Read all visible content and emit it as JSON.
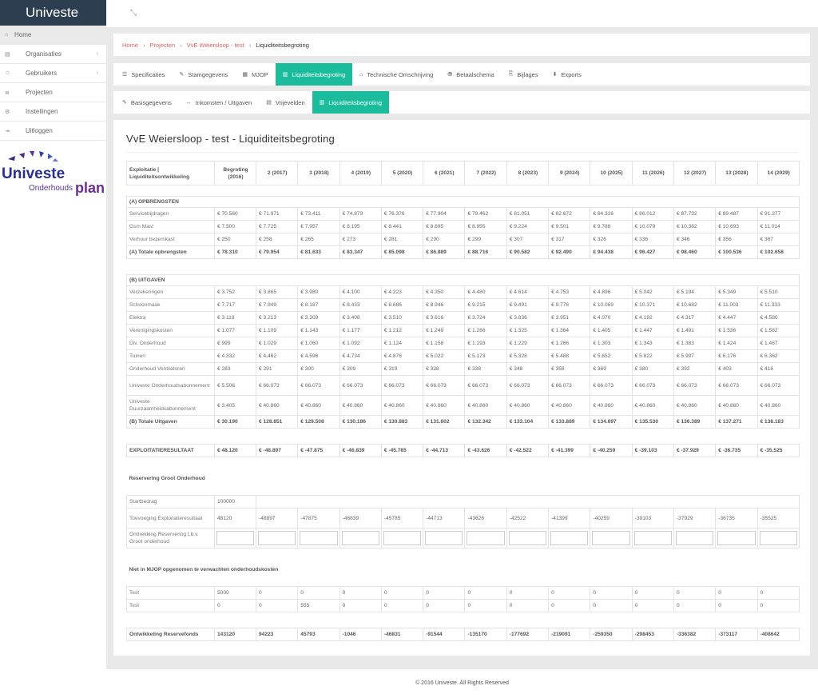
{
  "app_title": "Univeste",
  "sidebar": {
    "items": [
      {
        "icon": "dashboard-icon",
        "glyph": "⌂",
        "label": "Home"
      },
      {
        "icon": "building-icon",
        "glyph": "▤",
        "label": "Organisaties",
        "chevron": "‹"
      },
      {
        "icon": "users-icon",
        "glyph": "☺",
        "label": "Gebruikers",
        "chevron": "‹"
      },
      {
        "icon": "list-icon",
        "glyph": "≣",
        "label": "Projecten"
      },
      {
        "icon": "gear-icon",
        "glyph": "⚙",
        "label": "Instellingen"
      },
      {
        "icon": "logout-icon",
        "glyph": "⇥",
        "label": "Uitloggen"
      }
    ]
  },
  "logo": {
    "word": "Univeste",
    "sub": "Onderhouds",
    "plan": "plan"
  },
  "topbar": {
    "expand_glyph": "⤡"
  },
  "breadcrumb": {
    "home": "Home",
    "projects": "Projecten",
    "project": "VvE Weiersloop - test",
    "current": "Liquiditeitsbegroting"
  },
  "tabs1": [
    {
      "glyph": "☰",
      "label": "Specificaties"
    },
    {
      "glyph": "✎",
      "label": "Stamgegevens"
    },
    {
      "glyph": "▦",
      "label": "MJOP"
    },
    {
      "glyph": "▥",
      "label": "Liquiditeitsbegroting",
      "active": true
    },
    {
      "glyph": "⌂",
      "label": "Technische Omschrijving"
    },
    {
      "glyph": "⛃",
      "label": "Betaalschema"
    },
    {
      "glyph": "⎘",
      "label": "Bijlages"
    },
    {
      "glyph": "⬇",
      "label": "Exports"
    }
  ],
  "tabs2": [
    {
      "glyph": "✎",
      "label": "Basisgegevens"
    },
    {
      "glyph": "↔",
      "label": "Inkomsten / Uitgaven"
    },
    {
      "glyph": "▤",
      "label": "Vrijevelden"
    },
    {
      "glyph": "▥",
      "label": "Liquiditeitsbegroting",
      "active": true
    }
  ],
  "page_title": "VvE Weiersloop - test - Liquiditeitsbegroting",
  "table": {
    "head_label": "Exploitatie | Liquiditeitsontwikkeling",
    "columns": [
      "Begroting (2016)",
      "2 (2017)",
      "3 (2018)",
      "4 (2019)",
      "5 (2020)",
      "6 (2021)",
      "7 (2022)",
      "8 (2023)",
      "9 (2024)",
      "10 (2025)",
      "11 (2026)",
      "12 (2027)",
      "13 (2028)",
      "14 (2029)"
    ],
    "income_title": "(A) OPBRENGSTEN",
    "income_rows": [
      {
        "label": "Servicebijdragen",
        "values": [
          "€ 70.560",
          "€ 71.971",
          "€ 73.411",
          "€ 74.879",
          "€ 76.376",
          "€ 77.904",
          "€ 79.462",
          "€ 81.051",
          "€ 82.672",
          "€ 84.326",
          "€ 86.012",
          "€ 87.732",
          "€ 89.487",
          "€ 91.277"
        ]
      },
      {
        "label": "Gsm Mast",
        "values": [
          "€ 7.500",
          "€ 7.725",
          "€ 7.957",
          "€ 8.195",
          "€ 8.441",
          "€ 8.695",
          "€ 8.955",
          "€ 9.224",
          "€ 9.501",
          "€ 9.786",
          "€ 10.079",
          "€ 10.382",
          "€ 10.693",
          "€ 11.014"
        ]
      },
      {
        "label": "Verhuur bezemkast",
        "values": [
          "€ 250",
          "€ 258",
          "€ 265",
          "€ 273",
          "€ 281",
          "€ 290",
          "€ 299",
          "€ 307",
          "€ 317",
          "€ 326",
          "€ 336",
          "€ 346",
          "€ 356",
          "€ 367"
        ]
      }
    ],
    "income_total": {
      "label": "(A) Totale opbrengsten",
      "values": [
        "€ 78.310",
        "€ 79.954",
        "€ 81.633",
        "€ 83.347",
        "€ 85.098",
        "€ 86.889",
        "€ 88.716",
        "€ 90.582",
        "€ 92.490",
        "€ 94.438",
        "€ 96.427",
        "€ 98.460",
        "€ 100.536",
        "€ 102.658"
      ]
    },
    "expense_title": "(B) UITGAVEN",
    "expense_rows": [
      {
        "label": "Verzekeringen",
        "values": [
          "€ 3.752",
          "€ 3.865",
          "€ 3.980",
          "€ 4.100",
          "€ 4.223",
          "€ 4.350",
          "€ 4.480",
          "€ 4.614",
          "€ 4.753",
          "€ 4.896",
          "€ 5.042",
          "€ 5.194",
          "€ 5.349",
          "€ 5.510"
        ]
      },
      {
        "label": "Schoonmaak",
        "values": [
          "€ 7.717",
          "€ 7.949",
          "€ 8.187",
          "€ 8.433",
          "€ 8.686",
          "€ 8.946",
          "€ 9.215",
          "€ 9.491",
          "€ 9.776",
          "€ 10.069",
          "€ 10.371",
          "€ 10.682",
          "€ 11.003",
          "€ 11.333"
        ]
      },
      {
        "label": "Elektra",
        "values": [
          "€ 3.119",
          "€ 3.213",
          "€ 3.309",
          "€ 3.408",
          "€ 3.510",
          "€ 3.616",
          "€ 3.724",
          "€ 3.836",
          "€ 3.951",
          "€ 4.070",
          "€ 4.192",
          "€ 4.317",
          "€ 4.447",
          "€ 4.580"
        ]
      },
      {
        "label": "Verenigingskosten",
        "values": [
          "€ 1.077",
          "€ 1.109",
          "€ 1.143",
          "€ 1.177",
          "€ 1.212",
          "€ 1.249",
          "€ 1.286",
          "€ 1.325",
          "€ 1.364",
          "€ 1.405",
          "€ 1.447",
          "€ 1.491",
          "€ 1.536",
          "€ 1.582"
        ]
      },
      {
        "label": "Div. Onderhoud",
        "values": [
          "€ 999",
          "€ 1.029",
          "€ 1.060",
          "€ 1.092",
          "€ 1.124",
          "€ 1.158",
          "€ 1.193",
          "€ 1.229",
          "€ 1.266",
          "€ 1.303",
          "€ 1.343",
          "€ 1.383",
          "€ 1.424",
          "€ 1.467"
        ]
      },
      {
        "label": "Tuinen",
        "values": [
          "€ 4.332",
          "€ 4.462",
          "€ 4.596",
          "€ 4.734",
          "€ 4.876",
          "€ 5.022",
          "€ 5.173",
          "€ 5.328",
          "€ 5.488",
          "€ 5.652",
          "€ 5.822",
          "€ 5.997",
          "€ 6.176",
          "€ 6.362"
        ]
      },
      {
        "label": "Onderhoud Ventilatoren",
        "values": [
          "€ 283",
          "€ 291",
          "€ 300",
          "€ 309",
          "€ 319",
          "€ 328",
          "€ 338",
          "€ 348",
          "€ 358",
          "€ 369",
          "€ 380",
          "€ 392",
          "€ 403",
          "€ 416"
        ]
      },
      {
        "label": "Univeste Onderhoudsabonnement",
        "tall": true,
        "values": [
          "€ 5.506",
          "€ 66.073",
          "€ 66.073",
          "€ 66.073",
          "€ 66.073",
          "€ 66.073",
          "€ 66.073",
          "€ 66.073",
          "€ 66.073",
          "€ 66.073",
          "€ 66.073",
          "€ 66.073",
          "€ 66.073",
          "€ 66.073"
        ]
      },
      {
        "label": "Univeste Duurzaamheidsabonnement",
        "tall": true,
        "values": [
          "€ 3.405",
          "€ 40.860",
          "€ 40.860",
          "€ 40.860",
          "€ 40.860",
          "€ 40.860",
          "€ 40.860",
          "€ 40.860",
          "€ 40.860",
          "€ 40.860",
          "€ 40.860",
          "€ 40.860",
          "€ 40.860",
          "€ 40.860"
        ]
      }
    ],
    "expense_total": {
      "label": "(B) Totale Uitgaven",
      "values": [
        "€ 30.190",
        "€ 128.851",
        "€ 129.508",
        "€ 130.186",
        "€ 130.883",
        "€ 131.602",
        "€ 132.342",
        "€ 133.104",
        "€ 133.889",
        "€ 134.697",
        "€ 135.530",
        "€ 136.389",
        "€ 137.271",
        "€ 138.183"
      ]
    },
    "result": {
      "label": "EXPLOITATIERESULTAAT",
      "values": [
        "€ 48.120",
        "€ -48.897",
        "€ -47.875",
        "€ -46.839",
        "€ -45.785",
        "€ -44.713",
        "€ -43.626",
        "€ -42.522",
        "€ -41.399",
        "€ -40.259",
        "€ -39.103",
        "€ -37.929",
        "€ -36.735",
        "€ -35.525"
      ]
    },
    "reserve_title": "Reservering Groot Onderhoud",
    "startbedrag": {
      "label": "Startbedrag",
      "value": "100000"
    },
    "toevoeging": {
      "label": "Toevoeging Exploitatieresultaat",
      "values": [
        "48120",
        "-48897",
        "-47875",
        "-46839",
        "-45785",
        "-44713",
        "-43626",
        "-42522",
        "-41399",
        "-40259",
        "-39103",
        "-37929",
        "-36735",
        "-35525"
      ]
    },
    "onttrekking": {
      "label": "Onttrekking Reservering t.b.v. Groot onderhoud"
    },
    "mjop_title": "Niet in MJOP opgenomen te verwachten onderhoudskosten",
    "mjop_rows": [
      {
        "label": "Test",
        "values": [
          "5000",
          "0",
          "0",
          "0",
          "0",
          "0",
          "0",
          "0",
          "0",
          "0",
          "0",
          "0",
          "0",
          "0"
        ]
      },
      {
        "label": "Test",
        "values": [
          "0",
          "0",
          "555",
          "0",
          "0",
          "0",
          "0",
          "0",
          "0",
          "0",
          "0",
          "0",
          "0",
          "0"
        ]
      }
    ],
    "fund": {
      "label": "Ontwikkeling Reservefonds",
      "values": [
        "143120",
        "94223",
        "45793",
        "-1046",
        "-46831",
        "-91544",
        "-135170",
        "-177692",
        "-219091",
        "-259350",
        "-298453",
        "-336382",
        "-373117",
        "-408642"
      ]
    }
  },
  "footer": "© 2016 Univeste. All Rights Reserved"
}
